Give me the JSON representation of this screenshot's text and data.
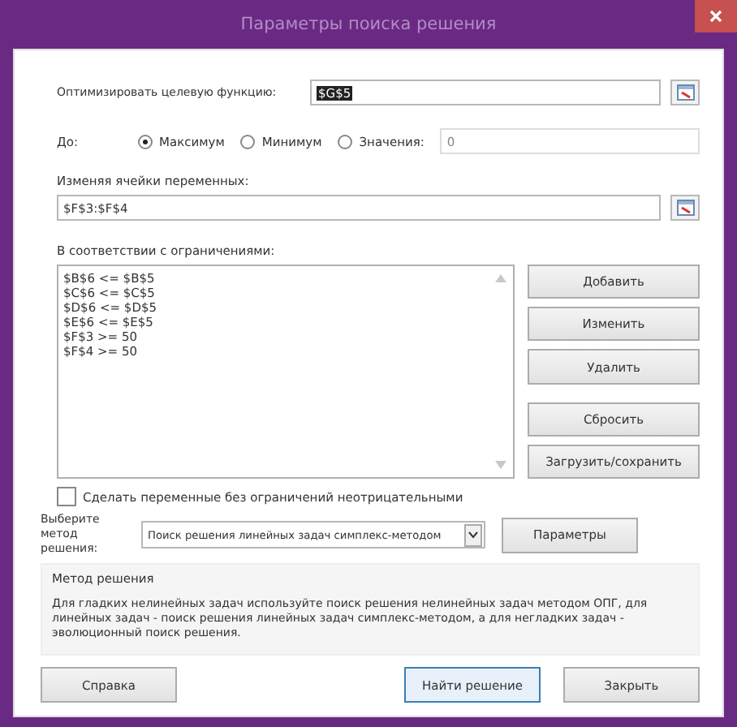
{
  "window": {
    "title": "Параметры поиска решения"
  },
  "objective": {
    "label": "Оптимизировать целевую функцию:",
    "value": "$G$5",
    "selected": true
  },
  "to": {
    "label": "До:",
    "options": [
      {
        "label": "Максимум",
        "selected": true
      },
      {
        "label": "Минимум",
        "selected": false
      },
      {
        "label": "Значения:",
        "selected": false
      }
    ],
    "value_field": {
      "value": "0",
      "disabled": true
    }
  },
  "variables": {
    "label": "Изменяя ячейки переменных:",
    "value": "$F$3:$F$4"
  },
  "constraints": {
    "label": "В соответствии с ограничениями:",
    "items": [
      "$B$6 <= $B$5",
      "$C$6 <= $C$5",
      "$D$6 <= $D$5",
      "$E$6 <= $E$5",
      "$F$3 >= 50",
      "$F$4 >= 50"
    ]
  },
  "side_buttons": [
    {
      "label": "Добавить",
      "gap": false
    },
    {
      "label": "Изменить",
      "gap": false
    },
    {
      "label": "Удалить",
      "gap": false
    },
    {
      "label": "Сбросить",
      "gap": true
    },
    {
      "label": "Загрузить/сохранить",
      "gap": false
    }
  ],
  "nonnegative": {
    "label": "Сделать переменные без ограничений неотрицательными",
    "checked": false
  },
  "method": {
    "label": "Выберите метод решения:",
    "value": "Поиск решения линейных задач симплекс-методом",
    "button": "Параметры"
  },
  "description": {
    "title": "Метод решения",
    "text": "Для гладких нелинейных задач используйте поиск решения нелинейных задач методом ОПГ, для линейных задач - поиск решения линейных задач симплекс-методом, а для негладких задач - эволюционный поиск решения."
  },
  "footer": [
    {
      "label": "Справка",
      "default": false
    },
    {
      "label": "Найти решение",
      "default": true
    },
    {
      "label": "Закрыть",
      "default": false
    }
  ]
}
